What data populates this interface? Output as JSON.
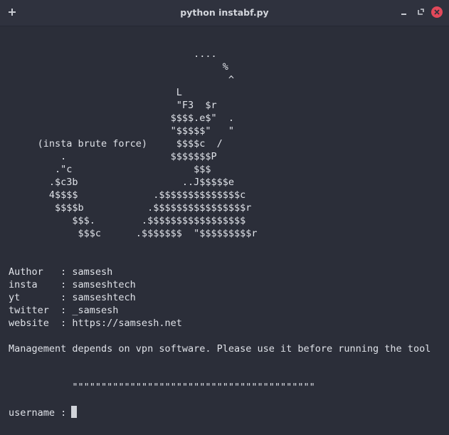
{
  "window": {
    "title": "python instabf.py",
    "new_tab_icon": "plus-icon",
    "minimize_icon": "minimize-icon",
    "maximize_icon": "restore-icon",
    "close_icon": "close-icon",
    "colors": {
      "background": "#2b2e39",
      "titlebar": "#2f323e",
      "text": "#dfe2e8",
      "close": "#e2485a"
    }
  },
  "terminal": {
    "art_lines": [
      "                                ....",
      "                                     %",
      "                                      ^",
      "                             L",
      "                             \"F3  $r",
      "                            $$$$.e$\"  .",
      "                            \"$$$$$\"   \"",
      "     (insta brute force)     $$$$c  /",
      "         .                  $$$$$$$P",
      "        .\"c                     $$$",
      "       .$c3b                  ..J$$$$$e",
      "       4$$$$             .$$$$$$$$$$$$$$c",
      "        $$$$b           .$$$$$$$$$$$$$$$$r",
      "           $$$.        .$$$$$$$$$$$$$$$$$",
      "            $$$c      .$$$$$$$  \"$$$$$$$$$r"
    ],
    "info_lines": [
      "Author   : samsesh",
      "insta    : samseshtech",
      "yt       : samseshtech",
      "twitter  : _samsesh",
      "website  : https://samsesh.net"
    ],
    "notice": "Management depends on vpn software. Please use it before running the tool",
    "separator": "           \"\"\"\"\"\"\"\"\"\"\"\"\"\"\"\"\"\"\"\"\"\"\"\"\"\"\"\"\"\"\"\"\"\"\"\"\"\"\"\"\"\"",
    "prompt": "username : "
  }
}
